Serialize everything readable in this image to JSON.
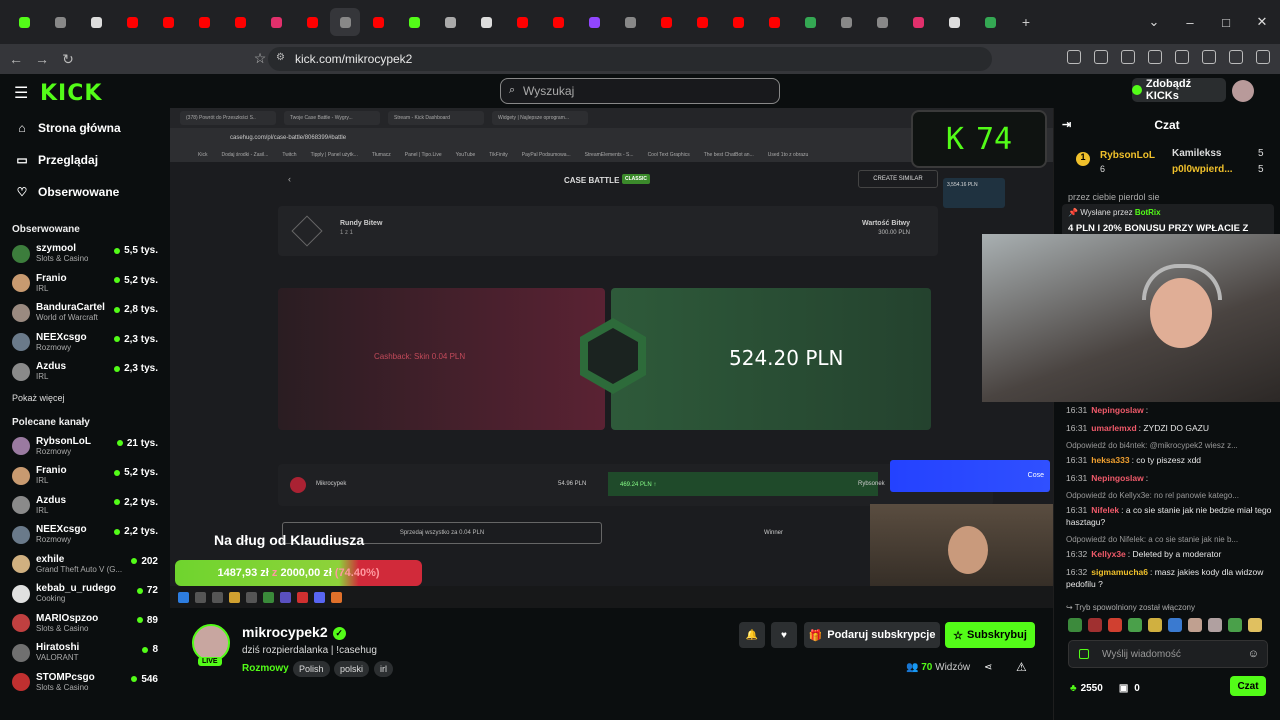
{
  "browser": {
    "url": "kick.com/mikrocypek2",
    "tabs": [
      {
        "icon": "kick",
        "color": "#53fc18"
      },
      {
        "icon": "doc",
        "color": "#888"
      },
      {
        "icon": "x",
        "color": "#ddd"
      },
      {
        "icon": "youtube",
        "color": "#ff0000"
      },
      {
        "icon": "youtube",
        "color": "#ff0000"
      },
      {
        "icon": "youtube",
        "color": "#ff0000"
      },
      {
        "icon": "youtube",
        "color": "#ff0000"
      },
      {
        "icon": "instagram",
        "color": "#e1306c"
      },
      {
        "icon": "youtube",
        "color": "#ff0000"
      },
      {
        "icon": "n",
        "color": "#888"
      },
      {
        "icon": "youtube",
        "color": "#ff0000"
      },
      {
        "icon": "kick",
        "color": "#53fc18"
      },
      {
        "icon": "t",
        "color": "#aaa"
      },
      {
        "icon": "x",
        "color": "#ddd"
      },
      {
        "icon": "youtube",
        "color": "#ff0000"
      },
      {
        "icon": "youtube",
        "color": "#ff0000"
      },
      {
        "icon": "twitch",
        "color": "#9146ff"
      },
      {
        "icon": "p",
        "color": "#888"
      },
      {
        "icon": "youtube",
        "color": "#ff0000"
      },
      {
        "icon": "youtube",
        "color": "#ff0000"
      },
      {
        "icon": "youtube",
        "color": "#ff0000"
      },
      {
        "icon": "youtube",
        "color": "#ff0000"
      },
      {
        "icon": "chrome",
        "color": "#34a853"
      },
      {
        "icon": "c",
        "color": "#888"
      },
      {
        "icon": "a",
        "color": "#888"
      },
      {
        "icon": "instagram",
        "color": "#e1306c"
      },
      {
        "icon": "tiktok",
        "color": "#ddd"
      },
      {
        "icon": "maps",
        "color": "#34a853"
      }
    ]
  },
  "header": {
    "logo": "KICK",
    "search_placeholder": "Wyszukaj",
    "kicks_button": "Zdobądź KICKs"
  },
  "sidebar": {
    "nav": [
      {
        "label": "Strona główna",
        "icon": "home-icon"
      },
      {
        "label": "Przeglądaj",
        "icon": "browse-icon"
      },
      {
        "label": "Obserwowane",
        "icon": "heart-icon"
      }
    ],
    "followed_title": "Obserwowane",
    "followed": [
      {
        "name": "szymool",
        "category": "Slots & Casino",
        "viewers": "5,5 tys.",
        "color": "#3c7d3c"
      },
      {
        "name": "Franio",
        "category": "IRL",
        "viewers": "5,2 tys.",
        "color": "#c89a70"
      },
      {
        "name": "BanduraCartel",
        "category": "World of Warcraft",
        "viewers": "2,8 tys.",
        "color": "#9a8a80"
      },
      {
        "name": "NEEXcsgo",
        "category": "Rozmowy",
        "viewers": "2,3 tys.",
        "color": "#6a7a8a"
      },
      {
        "name": "Azdus",
        "category": "IRL",
        "viewers": "2,3 tys.",
        "color": "#8a8a8a"
      }
    ],
    "show_more": "Pokaż więcej",
    "recommended_title": "Polecane kanały",
    "recommended": [
      {
        "name": "RybsonLoL",
        "category": "Rozmowy",
        "viewers": "21 tys.",
        "color": "#9a7aa0"
      },
      {
        "name": "Franio",
        "category": "IRL",
        "viewers": "5,2 tys.",
        "color": "#c89a70"
      },
      {
        "name": "Azdus",
        "category": "IRL",
        "viewers": "2,2 tys.",
        "color": "#8a8a8a"
      },
      {
        "name": "NEEXcsgo",
        "category": "Rozmowy",
        "viewers": "2,2 tys.",
        "color": "#6a7a8a"
      },
      {
        "name": "exhile",
        "category": "Grand Theft Auto V (G...",
        "viewers": "202",
        "color": "#d0b080"
      },
      {
        "name": "kebab_u_rudego",
        "category": "Cooking",
        "viewers": "72",
        "color": "#e0e0e0"
      },
      {
        "name": "MARIOspzoo",
        "category": "Slots & Casino",
        "viewers": "89",
        "color": "#c04040"
      },
      {
        "name": "Hiratoshi",
        "category": "VALORANT",
        "viewers": "8",
        "color": "#707070"
      },
      {
        "name": "STOMPcsgo",
        "category": "Slots & Casino",
        "viewers": "546",
        "color": "#c03030"
      }
    ]
  },
  "stream": {
    "inner": {
      "tabs": [
        "(378) Powrót do Przeszłości S..",
        "Twoje Case Battle - Wygry...",
        "Stream - Kick Dashboard",
        "Widgety | Najlepsze oprogram..."
      ],
      "url": "casehug.com/pl/case-battle/8068399#battle",
      "bookmarks": [
        "Kick",
        "Dodaj środki - Zasil...",
        "Twitch",
        "Tipply | Panel użytk...",
        "Tłumacz",
        "Panel | Tipo.Live",
        "YouTube",
        "TikFinity",
        "PayPal Podsumowa...",
        "StreamElements - S...",
        "Cool Text Graphics",
        "The best ChatBot an...",
        "Used 1to z obrazu"
      ],
      "title": "CASE BATTLE",
      "mode": "CLASSIC",
      "create_similar": "CREATE SIMILAR",
      "rounds_label": "Rundy Bitew",
      "rounds_value": "1 z 1",
      "battle_value_label": "Wartość Bitwy",
      "battle_value": "300.00 PLN",
      "cashback": "Cashback: Skin 0.04 PLN",
      "win_amount": "524.20 PLN",
      "player1": "Mikrocypek",
      "player1_value": "54.96 PLN",
      "player2_value": "469.24 PLN ↑",
      "player2": "Rybsonek",
      "sell_all": "Sprzedaj wszystko za 0.04 PLN",
      "winner": "Winner",
      "balance": "3,554.16 PLN",
      "counter": "74",
      "alert_name": "Cose"
    },
    "debt_title": "Na dług od Klaudiusza",
    "debt_current": "1487,93 zł",
    "debt_sep": "z",
    "debt_total": "2000,00 zł",
    "debt_percent": "(74.40%)",
    "debt_progress": 0.744
  },
  "streamer": {
    "name": "mikrocypek2",
    "live_label": "LIVE",
    "title": "dziś rozpierdalanka | !casehug",
    "category": "Rozmowy",
    "tags": [
      "Polish",
      "polski",
      "irl"
    ],
    "gift_button": "Podaruj subskrypcje",
    "subscribe_button": "Subskrybuj",
    "viewers_count": "70",
    "viewers_label": "Widzów"
  },
  "chat": {
    "title": "Czat",
    "leaderboard": [
      {
        "name": "RybsonLoL",
        "count": "6"
      },
      {
        "name": "Kamilekss",
        "count": "5"
      },
      {
        "name": "p0l0wpierd...",
        "count": "5"
      }
    ],
    "cut_message": "przez ciebie pierdol sie",
    "pinned_by_label": "Wysłane przez",
    "pinned_by": "BotRix",
    "pinned_message": "4 PLN I 20% BONUSU PRZY WPŁACIE Z",
    "messages": [
      {
        "time": "16:31",
        "user": "Nepingoslaw",
        "text": ":",
        "color": "#f05a6a"
      },
      {
        "time": "16:31",
        "user": "umarlemxd",
        "text": ": ZYDZI DO GAZU",
        "color": "#f05a6a"
      },
      {
        "reply": "Odpowiedź do bi4ntek: @mikrocypek2 wiesz z..."
      },
      {
        "time": "16:31",
        "user": "heksa333",
        "text": ": co ty piszesz xdd",
        "color": "#f0a030"
      },
      {
        "time": "16:31",
        "user": "Nepingoslaw",
        "text": ":",
        "color": "#f05a6a"
      },
      {
        "reply": "Odpowiedź do Kellyx3e: no rel panowie katego..."
      },
      {
        "time": "16:31",
        "user": "Nifelek",
        "text": ": a co sie stanie jak nie bedzie miał tego hasztagu?",
        "color": "#f05a6a"
      },
      {
        "reply": "Odpowiedź do Nifelek: a co sie stanie jak nie b..."
      },
      {
        "time": "16:32",
        "user": "Kellyx3e",
        "text": ": Deleted by a moderator",
        "color": "#f05a6a"
      },
      {
        "time": "16:32",
        "user": "sigmamucha6",
        "text": ": masz jakies kody dla widzow pedofilu ?",
        "color": "#f0c02b"
      }
    ],
    "system_message": "Tryb spowolniony został włączony",
    "input_placeholder": "Wyślij wiadomość",
    "points": "2550",
    "badge_count": "0",
    "chat_button": "Czat"
  }
}
